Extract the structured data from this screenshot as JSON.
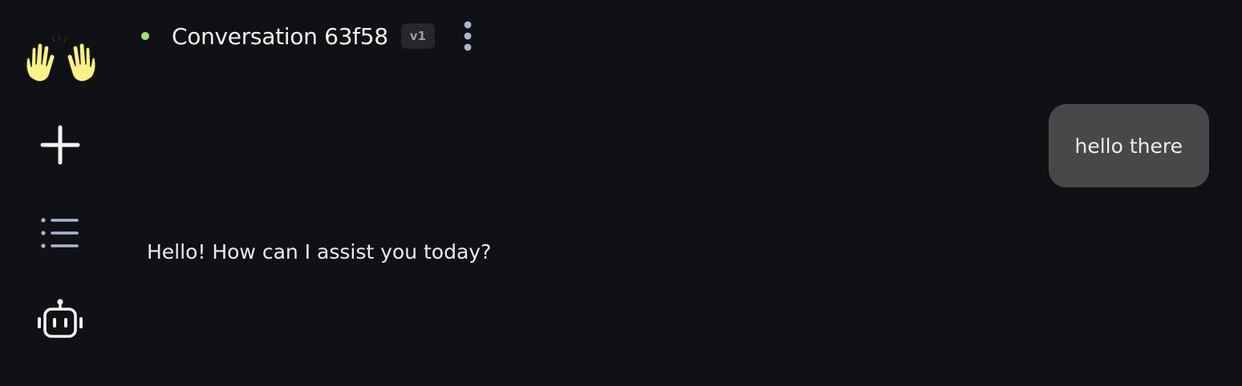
{
  "sidebar": {
    "logo_icon": "raising-hands-icon",
    "new_chat_icon": "plus-icon",
    "history_icon": "list-icon",
    "agents_icon": "bot-icon"
  },
  "header": {
    "status_color": "#9ee07a",
    "title": "Conversation 63f58",
    "version": "v1",
    "menu_icon": "more-vertical-icon"
  },
  "messages": [
    {
      "role": "user",
      "text": "hello there"
    },
    {
      "role": "assistant",
      "text": "Hello! How can I assist you today?"
    }
  ],
  "colors": {
    "background": "#101114",
    "user_bubble": "#48484b",
    "text": "#ececef"
  }
}
